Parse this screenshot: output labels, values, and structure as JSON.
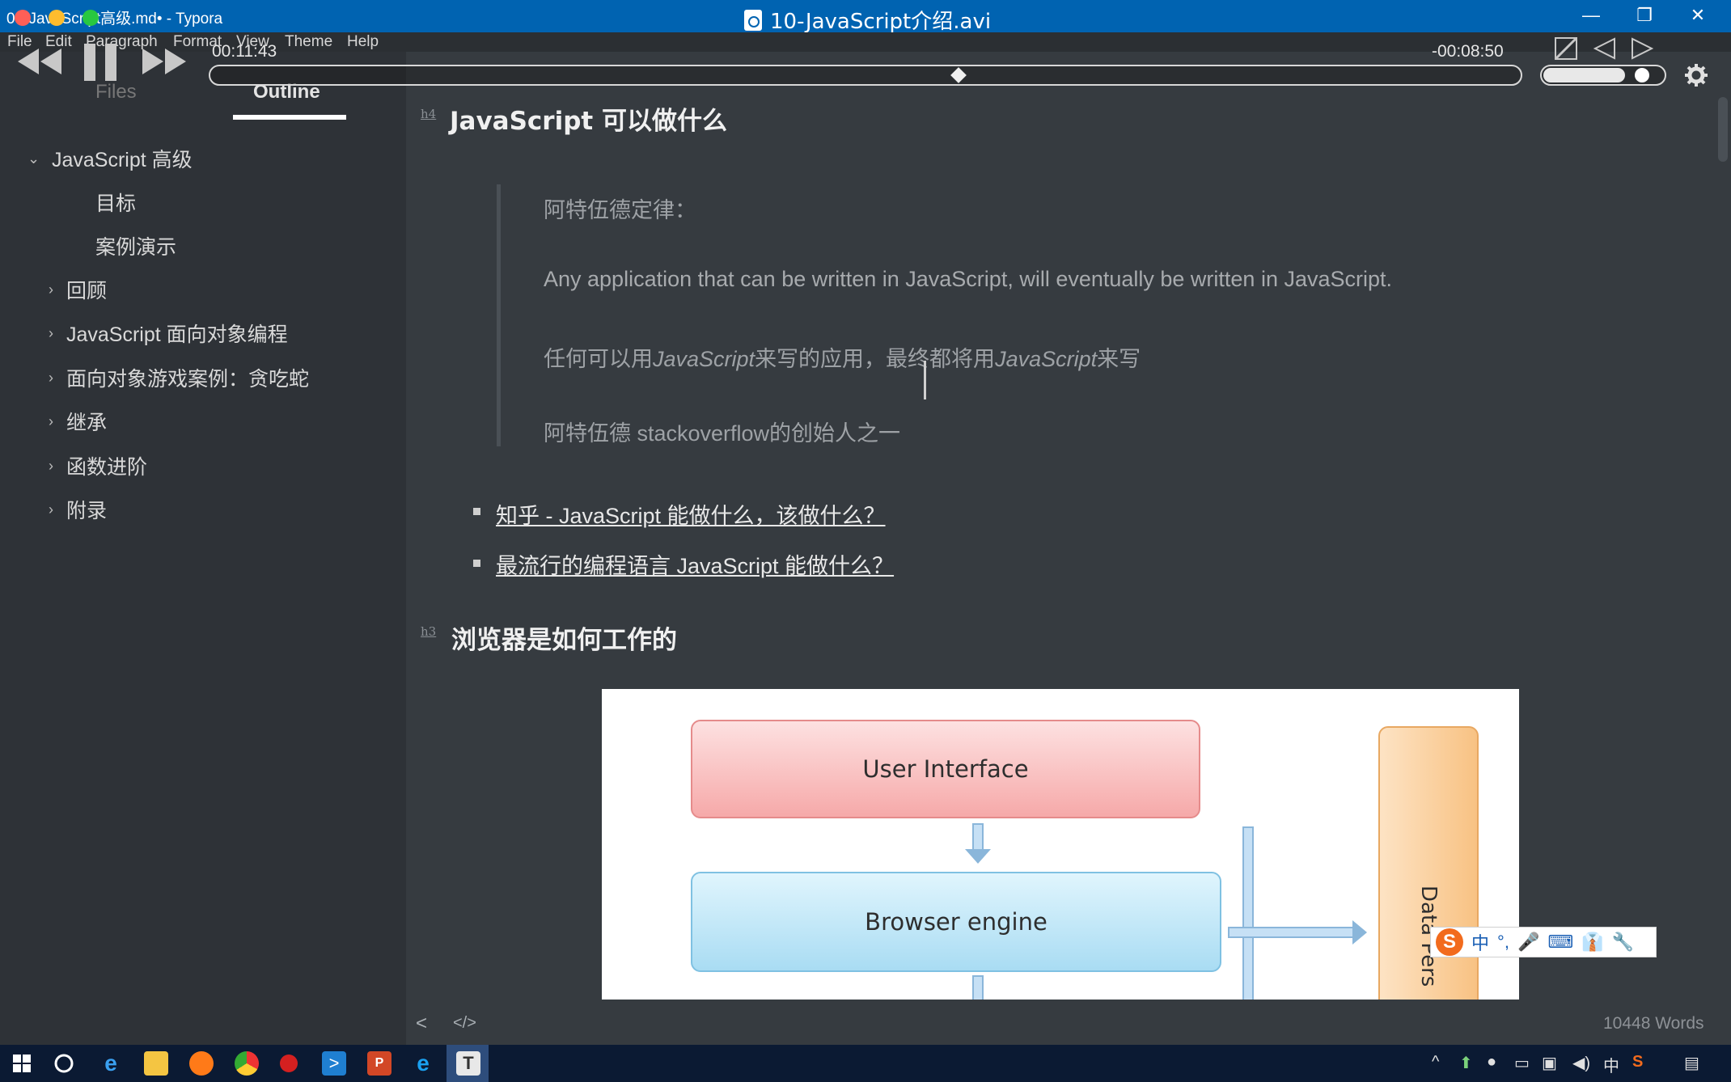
{
  "window": {
    "app_title": "03-JavaScript高级.md• - Typora",
    "video_title": "10-JavaScript介绍.avi"
  },
  "menu": [
    "File",
    "Edit",
    "Paragraph",
    "Format",
    "View",
    "Theme",
    "Help"
  ],
  "player": {
    "elapsed": "00:11:43",
    "remaining": "-00:08:50",
    "progress_fraction": 0.57,
    "volume_fraction": 0.68
  },
  "sidebar": {
    "tabs": [
      "Files",
      "Outline"
    ],
    "active_tab": "Outline",
    "outline": [
      {
        "label": "JavaScript 高级",
        "level": 0,
        "expanded": true
      },
      {
        "label": "目标",
        "level": 1
      },
      {
        "label": "案例演示",
        "level": 1
      },
      {
        "label": "回顾",
        "level": 0,
        "expanded": false
      },
      {
        "label": "JavaScript 面向对象编程",
        "level": 0,
        "expanded": false
      },
      {
        "label": "面向对象游戏案例：贪吃蛇",
        "level": 0,
        "expanded": false
      },
      {
        "label": "继承",
        "level": 0,
        "expanded": false
      },
      {
        "label": "函数进阶",
        "level": 0,
        "expanded": false
      },
      {
        "label": "附录",
        "level": 0,
        "expanded": false
      }
    ]
  },
  "document": {
    "h4_marker": "h4",
    "h4": "JavaScript 可以做什么",
    "quote": {
      "line1": "阿特伍德定律：",
      "line2": "Any application that can be written in JavaScript, will eventually be written in JavaScript.",
      "line3_a": "任何可以用",
      "line3_b": "JavaScript",
      "line3_c": "来写的应用，最终都将用",
      "line3_d": "JavaScript",
      "line3_e": "来写",
      "line4": "阿特伍德 stackoverflow的创始人之一"
    },
    "links": [
      "知乎 - JavaScript 能做什么，该做什么？",
      "最流行的编程语言 JavaScript 能做什么？"
    ],
    "h3_marker": "h3",
    "h3": "浏览器是如何工作的",
    "diagram": {
      "box1": "User  Interface",
      "box2": "Browser engine",
      "side": "Data Pers"
    }
  },
  "ime": {
    "logo": "S",
    "items": [
      "中",
      "°,",
      "🎤",
      "⌨",
      "👔",
      "🔧"
    ]
  },
  "footer": {
    "word_count": "10448 Words"
  },
  "colors": {
    "titlebar": "#0063b1",
    "sidebar": "#2e3237",
    "editor": "#363b40",
    "ui_box": "#f8b4b4",
    "engine_box": "#b9e4f7",
    "data_box": "#f9c98f"
  },
  "taskbar": {
    "icons": [
      "windows-start-icon",
      "cortana-icon",
      "edge-icon",
      "file-explorer-icon",
      "firefox-icon",
      "chrome-icon",
      "record-icon",
      "vscode-icon",
      "powerpoint-icon",
      "ie-icon",
      "typora-icon"
    ],
    "tray_ime": "中"
  }
}
